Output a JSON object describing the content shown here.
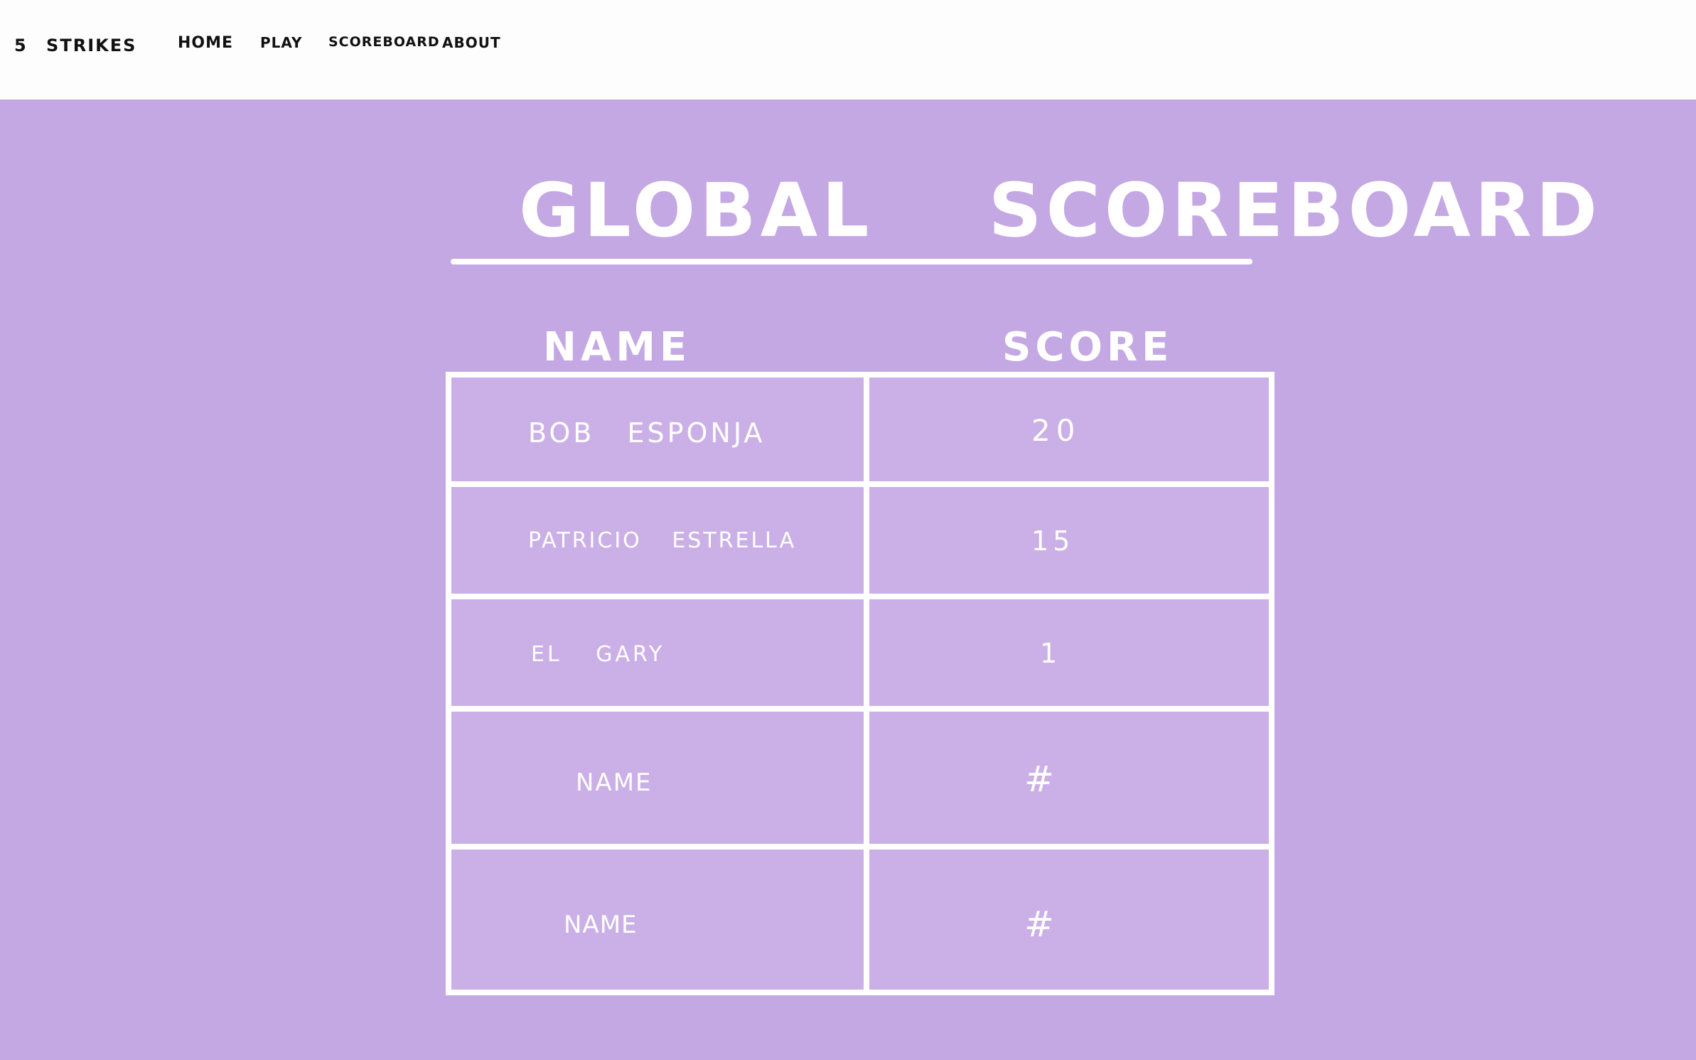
{
  "nav": {
    "brand": "5 STRIKES",
    "items": [
      {
        "label": "HOME"
      },
      {
        "label": "PLAY"
      },
      {
        "label": "SCOREBOARD"
      },
      {
        "label": "ABOUT"
      }
    ]
  },
  "page": {
    "title": "GLOBAL SCOREBOARD"
  },
  "table": {
    "headers": {
      "name": "NAME",
      "score": "SCORE"
    },
    "rows": [
      {
        "name": "BOB ESPONJA",
        "score": "20"
      },
      {
        "name": "PATRICIO ESTRELLA",
        "score": "15"
      },
      {
        "name": "EL GARY",
        "score": "1"
      },
      {
        "name": "NAME",
        "score": "#"
      },
      {
        "name": "NAME",
        "score": "#"
      }
    ]
  },
  "colors": {
    "background": "#c4a8e4",
    "table_fill": "#cbb0e8",
    "header_bar": "#fdfdfd",
    "text_light": "#ffffff",
    "text_dark": "#111111"
  }
}
